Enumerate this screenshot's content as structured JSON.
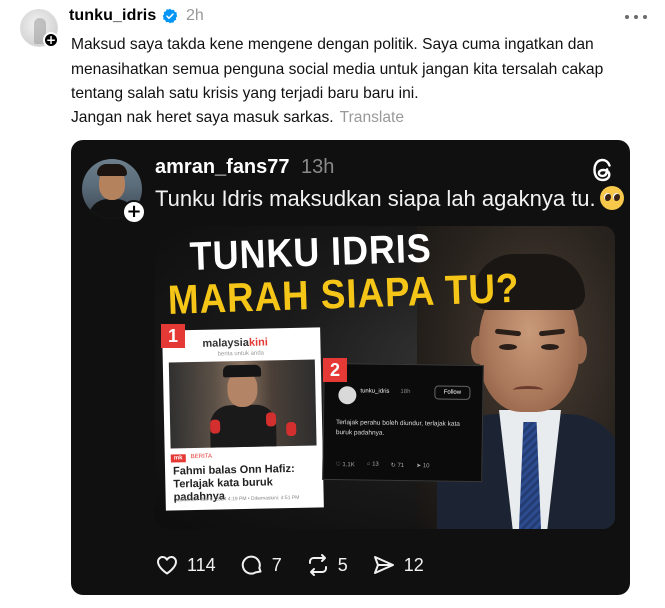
{
  "post": {
    "username": "tunku_idris",
    "verified": true,
    "time": "2h",
    "paragraph1": "Maksud saya takda kene mengene dengan politik. Saya cuma ingatkan dan menasihatkan semua penguna social media untuk jangan kita tersalah cakap tentang salah satu krisis yang terjadi baru baru ini.",
    "paragraph2": "Jangan nak heret saya masuk sarkas.",
    "translate_label": "Translate",
    "avatar_plus": "+"
  },
  "quoted": {
    "username": "amran_fans77",
    "time": "13h",
    "text": "Tunku Idris maksudkan siapa lah agaknya tu.",
    "emoji": "pleading-face-emoji",
    "avatar_plus": "+",
    "image": {
      "headline_line1": "TUNKU IDRIS",
      "headline_line2": "MARAH SIAPA TU?",
      "panel1": {
        "number": "1",
        "site_logo_a": "malaysia",
        "site_logo_b": "kini",
        "site_tagline": "berita untuk anda",
        "tag": "BERITA",
        "tag_prefix": "mk",
        "headline": "Fahmi balas Onn Hafiz: Terlajak kata buruk padahnya",
        "dateline": "Diterbitkan: Jun 6, 2024 4:19 PM • Dikemaskini: 4:51 PM"
      },
      "panel2": {
        "number": "2",
        "username": "tunku_idris",
        "time": "18h",
        "follow_label": "Follow",
        "text": "Terlajak perahu boleh diundur, terlajak kata buruk padahnya.",
        "likes": "1.1K",
        "replies": "13",
        "reposts": "71",
        "shares": "10"
      }
    },
    "actions": {
      "likes": "114",
      "replies": "7",
      "reposts": "5",
      "shares": "12"
    }
  },
  "colors": {
    "card_bg": "#101010",
    "headline_yellow": "#f5c518",
    "badge_red": "#e53935",
    "verified_blue": "#0095f6"
  }
}
